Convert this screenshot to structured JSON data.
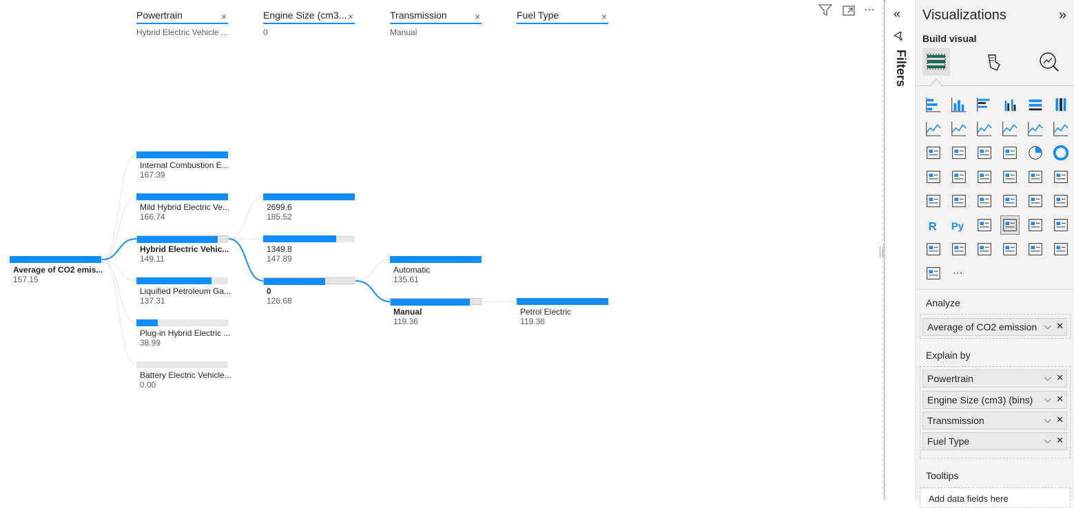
{
  "levels": [
    {
      "title": "Powertrain",
      "selected": "Hybrid Electric Vehicle ..."
    },
    {
      "title": "Engine Size (cm3...",
      "selected": "0"
    },
    {
      "title": "Transmission",
      "selected": "Manual"
    },
    {
      "title": "Fuel Type",
      "selected": ""
    }
  ],
  "root": {
    "label": "Average of CO2 emis...",
    "value": "157.15",
    "fill": 1.0
  },
  "col1": [
    {
      "label": "Internal Combustion E...",
      "value": "167.39",
      "fill": 1.0
    },
    {
      "label": "Mild Hybrid Electric Ve...",
      "value": "166.74",
      "fill": 1.0
    },
    {
      "label": "Hybrid Electric Vehic...",
      "value": "149.11",
      "fill": 0.89,
      "selected": true
    },
    {
      "label": "Liquified Petroleum Ga...",
      "value": "137.31",
      "fill": 0.82
    },
    {
      "label": "Plug-in Hybrid Electric ...",
      "value": "38.99",
      "fill": 0.23
    },
    {
      "label": "Battery Electric Vehicle...",
      "value": "0.00",
      "fill": 0.0
    }
  ],
  "col2": [
    {
      "label": "2699.6",
      "value": "185.52",
      "fill": 1.0
    },
    {
      "label": "1349.8",
      "value": "147.89",
      "fill": 0.8
    },
    {
      "label": "0",
      "value": "126.68",
      "fill": 0.68,
      "selected": true
    }
  ],
  "col3": [
    {
      "label": "Automatic",
      "value": "135.61",
      "fill": 1.0
    },
    {
      "label": "Manual",
      "value": "119.36",
      "fill": 0.88,
      "selected": true
    }
  ],
  "col4": [
    {
      "label": "Petrol Electric",
      "value": "119.36",
      "fill": 1.0
    }
  ],
  "filters_label": "Filters",
  "viz": {
    "title": "Visualizations",
    "build_visual": "Build visual",
    "analyze_title": "Analyze",
    "analyze_field": "Average of CO2 emission",
    "explain_title": "Explain by",
    "explain_fields": [
      "Powertrain",
      "Engine Size (cm3) (bins)",
      "Transmission",
      "Fuel Type"
    ],
    "tooltips_title": "Tooltips",
    "add_fields": "Add data fields here"
  },
  "colors": {
    "accent": "#118DFF",
    "bar_bg": "#E6E6E6"
  }
}
